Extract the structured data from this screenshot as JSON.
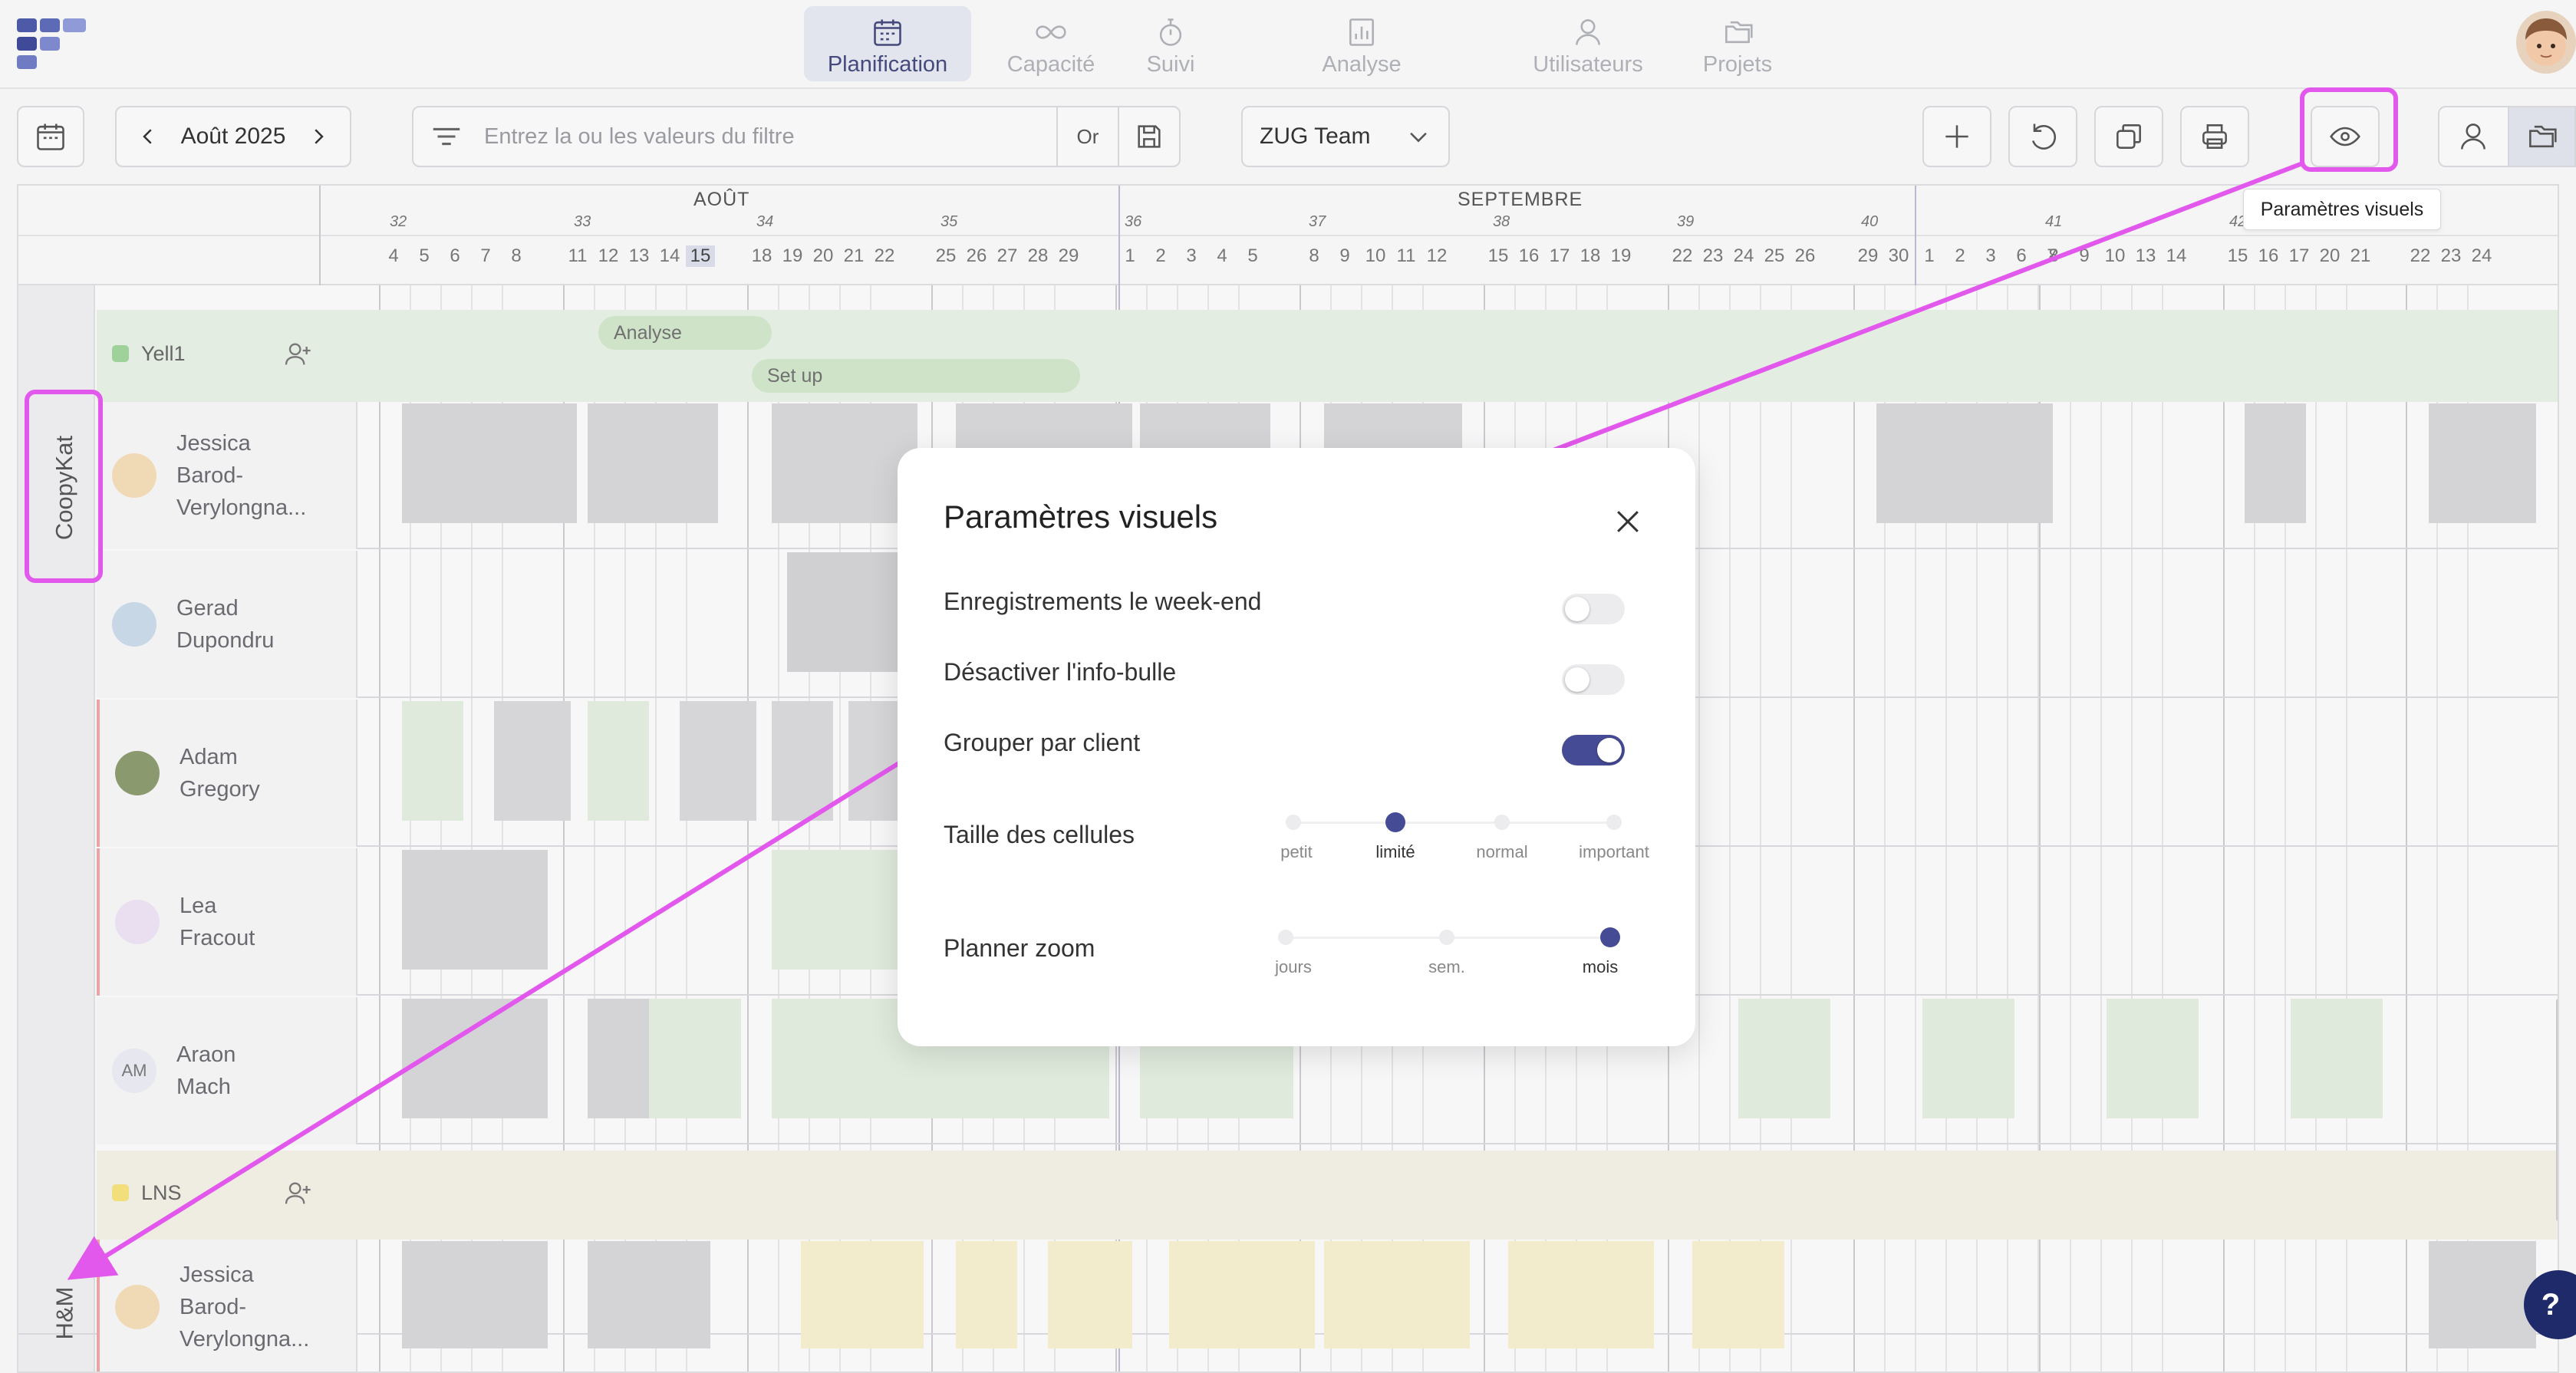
{
  "nav": {
    "items": [
      {
        "label": "Planification",
        "icon": "calendar-icon",
        "active": true
      },
      {
        "label": "Capacité",
        "icon": "infinity-icon"
      },
      {
        "label": "Suivi",
        "icon": "stopwatch-icon"
      },
      {
        "label": "Analyse",
        "icon": "bar-chart-icon"
      },
      {
        "label": "Utilisateurs",
        "icon": "user-icon"
      },
      {
        "label": "Projets",
        "icon": "folders-icon"
      }
    ]
  },
  "toolbar": {
    "month": "Août 2025",
    "filter_placeholder": "Entrez la ou les valeurs du filtre",
    "or_label": "Or",
    "team": "ZUG Team",
    "tooltip": "Paramètres visuels"
  },
  "timeline": {
    "months": [
      "AOÛT",
      "SEPTEMBRE"
    ],
    "weeks": [
      "32",
      "33",
      "34",
      "35",
      "36",
      "37",
      "38",
      "39",
      "40",
      "41",
      "42"
    ],
    "days_aug": [
      "4",
      "5",
      "6",
      "7",
      "8",
      "11",
      "12",
      "13",
      "14",
      "15",
      "18",
      "19",
      "20",
      "21",
      "22",
      "25",
      "26",
      "27",
      "28",
      "29"
    ],
    "days_sep": [
      "1",
      "2",
      "3",
      "4",
      "5",
      "8",
      "9",
      "10",
      "11",
      "12",
      "15",
      "16",
      "17",
      "18",
      "19",
      "22",
      "23",
      "24",
      "25",
      "26",
      "29",
      "30"
    ],
    "days_oct": [
      "1",
      "2",
      "3",
      "6",
      "7",
      "8",
      "9",
      "10",
      "13",
      "14",
      "15",
      "16",
      "17",
      "20",
      "21",
      "22",
      "23",
      "24"
    ],
    "today": "15"
  },
  "groups": [
    {
      "name": "CoopyKat"
    },
    {
      "name": "H&M"
    }
  ],
  "clients": {
    "yell": {
      "name": "Yell1",
      "color": "#9fd29a",
      "bars": [
        "Analyse",
        "Set up"
      ]
    },
    "lns": {
      "name": "LNS",
      "color": "#f2df7c"
    }
  },
  "people": [
    {
      "first": "Jessica",
      "last": "Barod-",
      "last2": "Verylongna..."
    },
    {
      "first": "Gerad",
      "last": "Dupondru"
    },
    {
      "first": "Adam",
      "last": "Gregory"
    },
    {
      "first": "Lea",
      "last": "Fracout"
    },
    {
      "first": "Araon",
      "last": "Mach",
      "initials": "AM"
    },
    {
      "first": "Jessica",
      "last": "Barod-",
      "last2": "Verylongna..."
    }
  ],
  "modal": {
    "title": "Paramètres visuels",
    "weekend": {
      "label": "Enregistrements le week-end",
      "on": false
    },
    "tooltip_off": {
      "label": "Désactiver l'info-bulle",
      "on": false
    },
    "group_client": {
      "label": "Grouper par client",
      "on": true
    },
    "cell_size": {
      "label": "Taille des cellules",
      "options": [
        "petit",
        "limité",
        "normal",
        "important"
      ],
      "selected": "limité"
    },
    "zoom": {
      "label": "Planner zoom",
      "options": [
        "jours",
        "sem.",
        "mois"
      ],
      "selected": "mois"
    }
  },
  "help_label": "?"
}
